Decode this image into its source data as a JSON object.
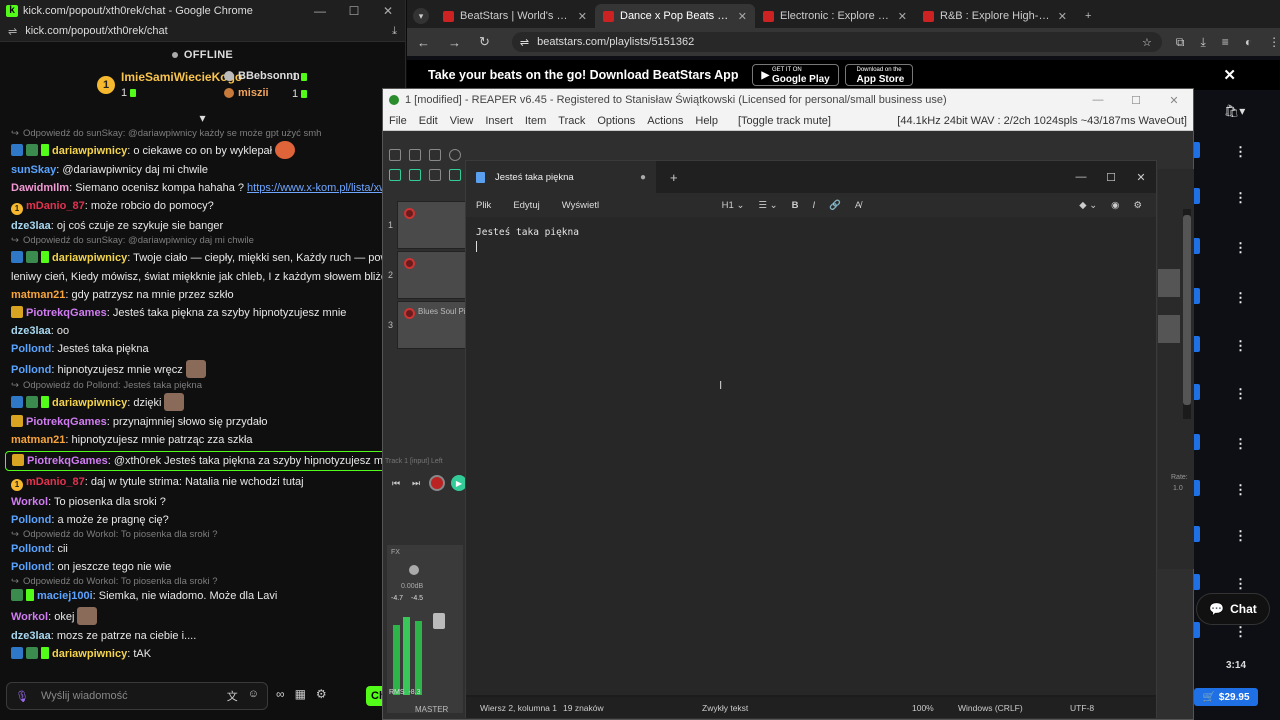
{
  "kick": {
    "window_title": "kick.com/popout/xth0rek/chat - Google Chrome",
    "url": "kick.com/popout/xth0rek/chat",
    "status": "OFFLINE",
    "top_gifters": [
      {
        "rank": "1",
        "name": "ImieSamiWiecieKogo",
        "count": "1"
      },
      {
        "name": "BBebsonnn",
        "count": "1"
      },
      {
        "name": "miszii",
        "count": "1"
      }
    ],
    "input_placeholder": "Wyślij wiadomość",
    "chat_button": "Ch",
    "messages": [
      {
        "reply": "Odpowiedź do sunSkay: @dariawpiwnicy każdy se może gpt użyć smh",
        "user": "dariawpiwnicy",
        "color": "#f4d44a",
        "badges": "blue-green-gem",
        "text": "o ciekawe co on by wyklepał"
      },
      {
        "user": "sunSkay",
        "color": "#5aa3ff",
        "badges": "",
        "text": "@dariawpiwnicy daj mi chwile"
      },
      {
        "user": "DawidmIlm",
        "color": "#f19ad3",
        "badges": "",
        "text": "Siemano ocenisz kompa hahaha ? ",
        "link": "https://www.x-kom.pl/lista/xwnyleg6h"
      },
      {
        "user": "mDanio_87",
        "color": "#e2324f",
        "badges": "rank1",
        "text": "może robcio do pomocy?"
      },
      {
        "user": "dze3laa",
        "color": "#a8d8f0",
        "badges": "",
        "text": "oj coś czuje ze szykuje sie banger"
      },
      {
        "reply": "Odpowiedź do sunSkay: @dariawpiwnicy daj mi chwile",
        "user": "dariawpiwnicy",
        "color": "#f4d44a",
        "badges": "blue-green-gem",
        "text": "Twoje ciało — ciepły, miękki sen, Każdy ruch — powietrza"
      },
      {
        "cont": "leniwy cień, Kiedy mówisz, świat miękknie jak chleb, I z każdym słowem bliżej nieb."
      },
      {
        "user": "matman21",
        "color": "#f7a53b",
        "badges": "",
        "text": "gdy patrzysz na mnie przez szkło"
      },
      {
        "user": "PiotrekqGames",
        "color": "#d17cf2",
        "badges": "crown",
        "text": "Jesteś taka piękna za szyby hipnotyzujesz mnie"
      },
      {
        "user": "dze3laa",
        "color": "#a8d8f0",
        "badges": "",
        "text": "oo"
      },
      {
        "user": "Pollond",
        "color": "#5aa3ff",
        "badges": "",
        "text": "Jesteś taka piękna"
      },
      {
        "user": "Pollond",
        "color": "#5aa3ff",
        "badges": "",
        "text": "hipnotyzujesz mnie wręcz"
      },
      {
        "reply": "Odpowiedź do Pollond: Jesteś taka piękna",
        "user": "dariawpiwnicy",
        "color": "#f4d44a",
        "badges": "blue-green-gem",
        "text": "dzięki"
      },
      {
        "user": "PiotrekqGames",
        "color": "#d17cf2",
        "badges": "crown",
        "text": "przynajmniej słowo się przydało"
      },
      {
        "user": "matman21",
        "color": "#f7a53b",
        "badges": "",
        "text": "hipnotyzujesz mnie patrząc zza szkła"
      },
      {
        "user": "PiotrekqGames",
        "color": "#d17cf2",
        "badges": "crown",
        "text": "@xth0rek Jesteś taka piękna za szyby hipnotyzujesz mnie",
        "highlight": true
      },
      {
        "user": "mDanio_87",
        "color": "#e2324f",
        "badges": "rank1",
        "text": "daj w tytule strima: Natalia nie wchodzi tutaj"
      },
      {
        "user": "Workol",
        "color": "#d17cf2",
        "badges": "",
        "text": "To piosenka dla sroki ?"
      },
      {
        "user": "Pollond",
        "color": "#5aa3ff",
        "badges": "",
        "text": "a może że pragnę cię?"
      },
      {
        "reply": "Odpowiedź do Workol: To piosenka dla sroki ?",
        "user": "Pollond",
        "color": "#5aa3ff",
        "badges": "",
        "text": "cii"
      },
      {
        "user": "Pollond",
        "color": "#5aa3ff",
        "badges": "",
        "text": "on jeszcze tego nie wie"
      },
      {
        "reply": "Odpowiedź do Workol: To piosenka dla sroki ?",
        "user": "maciej100i",
        "color": "#5aa3ff",
        "badges": "gem2",
        "text": "Siemka, nie wiadomo. Może dla Lavi"
      },
      {
        "user": "Workol",
        "color": "#d17cf2",
        "badges": "",
        "text": "okej"
      },
      {
        "user": "dze3laa",
        "color": "#a8d8f0",
        "badges": "",
        "text": "mozs ze patrze na ciebie i...."
      },
      {
        "user": "dariawpiwnicy",
        "color": "#f4d44a",
        "badges": "blue-green-gem",
        "text": "tAK"
      }
    ]
  },
  "browser": {
    "tabs": [
      {
        "label": "BeatStars | World's #1 Music Ma",
        "active": false
      },
      {
        "label": "Dance x Pop Beats by Fantom -",
        "active": true
      },
      {
        "label": "Electronic : Explore High-Qualit",
        "active": false
      },
      {
        "label": "R&B : Explore High-Quality R&B",
        "active": false
      }
    ],
    "url": "beatstars.com/playlists/5151362",
    "promo_text": "Take your beats on the go! Download BeatStars App",
    "google_play_small": "GET IT ON",
    "google_play": "Google Play",
    "app_store_small": "Download on the",
    "app_store": "App Store",
    "chat_label": "Chat",
    "price": "$29.95",
    "time": "3:14"
  },
  "reaper": {
    "title": "1 [modified] - REAPER v6.45 - Registered to Stanisław Świątkowski (Licensed for personal/small business use)",
    "menu": [
      "File",
      "Edit",
      "View",
      "Insert",
      "Item",
      "Track",
      "Options",
      "Actions",
      "Help",
      "[Toggle track mute]"
    ],
    "info": "[44.1kHz 24bit WAV : 2/2ch 1024spls ~43/187ms WaveOut]",
    "track_names": [
      "",
      "",
      "Blues Soul Pi"
    ],
    "track_numbers": [
      "1",
      "2",
      "3"
    ],
    "track_input": "Track 1 [input] Left",
    "fx_label": "FX",
    "vol_db": "0.00dB",
    "peak_l": "-4.7",
    "peak_r": "-4.5",
    "rms_label": "RMS",
    "rms_val": "-8.3",
    "master_label": "MASTER",
    "rate_label": "Rate:",
    "rate_val": "1.0"
  },
  "notepad": {
    "tab_title": "Jesteś taka piękna",
    "menu": [
      "Plik",
      "Edytuj",
      "Wyświetl"
    ],
    "heading": "H1",
    "content": "Jesteś taka piękna",
    "status_position": "Wiersz 2, kolumna 1",
    "status_chars": "19 znaków",
    "status_mode": "Zwykły tekst",
    "status_zoom": "100%",
    "status_eol": "Windows (CRLF)",
    "status_enc": "UTF-8"
  }
}
